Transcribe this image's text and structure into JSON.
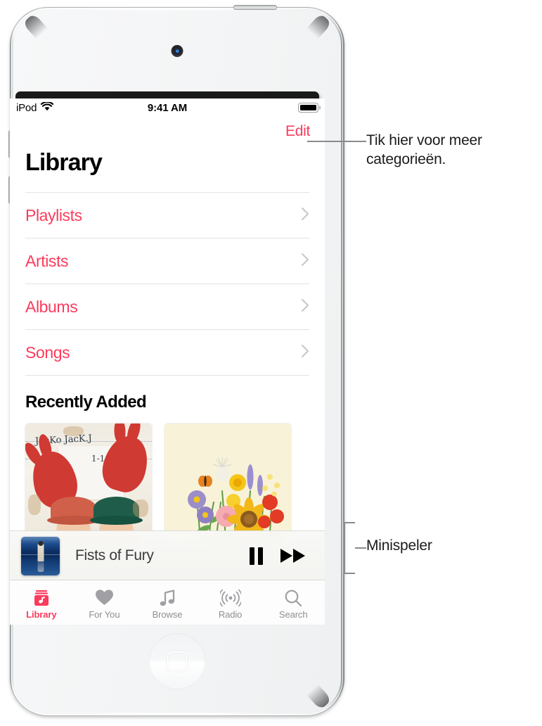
{
  "device": {
    "name": "iPod touch",
    "camera": "front-camera",
    "home_button": "home-button"
  },
  "status_bar": {
    "carrier": "iPod",
    "wifi": "wifi-icon",
    "time": "9:41 AM",
    "battery": "battery-full-icon"
  },
  "nav": {
    "edit_label": "Edit"
  },
  "header": {
    "title": "Library"
  },
  "library_rows": [
    {
      "label": "Playlists",
      "chevron": "chevron-right-icon"
    },
    {
      "label": "Artists",
      "chevron": "chevron-right-icon"
    },
    {
      "label": "Albums",
      "chevron": "chevron-right-icon"
    },
    {
      "label": "Songs",
      "chevron": "chevron-right-icon"
    }
  ],
  "recently_added": {
    "title": "Recently Added",
    "albums": [
      {
        "art": "kids-handprints-photo",
        "caption_line1": "JacKo  JacK.J",
        "caption_line2": "1-11-02"
      },
      {
        "art": "wildflowers-illustration"
      }
    ]
  },
  "mini_player": {
    "artwork": "figure-on-blue-water-album-art",
    "track_title": "Fists of Fury",
    "pause_label": "pause-button",
    "next_label": "fast-forward-button"
  },
  "tab_bar": {
    "items": [
      {
        "label": "Library",
        "icon": "library-icon",
        "active": true
      },
      {
        "label": "For You",
        "icon": "heart-icon",
        "active": false
      },
      {
        "label": "Browse",
        "icon": "music-note-icon",
        "active": false
      },
      {
        "label": "Radio",
        "icon": "radio-broadcast-icon",
        "active": false
      },
      {
        "label": "Search",
        "icon": "magnifying-glass-icon",
        "active": false
      }
    ]
  },
  "callouts": [
    {
      "text": "Tik hier voor meer categorieën.",
      "target": "edit-button"
    },
    {
      "text": "Minispeler",
      "target": "mini-player"
    }
  ],
  "colors": {
    "accent_pink": "#fb3b5c",
    "tab_inactive": "#8e8e93",
    "separator": "#e3e3e3",
    "callout_line": "#8b8b8b"
  }
}
